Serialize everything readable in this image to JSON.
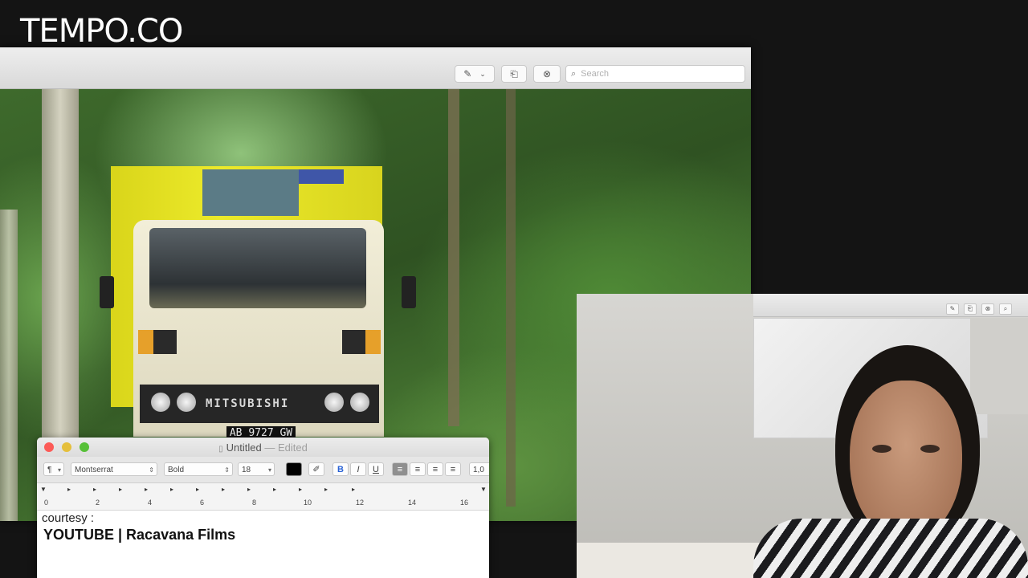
{
  "watermark": {
    "logo_text": "TEMPO.CO"
  },
  "preview_window": {
    "toolbar": {
      "markup_icon": "pen-icon",
      "markup_chevron": "chevron-down-icon",
      "share_icon": "share-icon",
      "markup_toolbar_icon": "marker-circle-icon",
      "search_placeholder": "Search"
    },
    "photo": {
      "truck_brand": "MITSUBISHI",
      "plate": "AB 9727 GW"
    }
  },
  "textedit_window": {
    "title": "Untitled",
    "edited_suffix": "— Edited",
    "format_bar": {
      "paragraph_style": "¶",
      "font_family": "Montserrat",
      "font_style": "Bold",
      "font_size": "18",
      "bold": "B",
      "italic": "I",
      "underline": "U",
      "line_spacing": "1,0"
    },
    "ruler_labels": [
      "0",
      "2",
      "4",
      "6",
      "8",
      "10",
      "12",
      "14",
      "16"
    ],
    "body": {
      "line1": "courtesy :",
      "line2": "YOUTUBE | Racavana Films"
    },
    "colors": {
      "close": "#fc5b57",
      "minimize": "#e5bf3c",
      "zoom": "#57c038"
    }
  }
}
